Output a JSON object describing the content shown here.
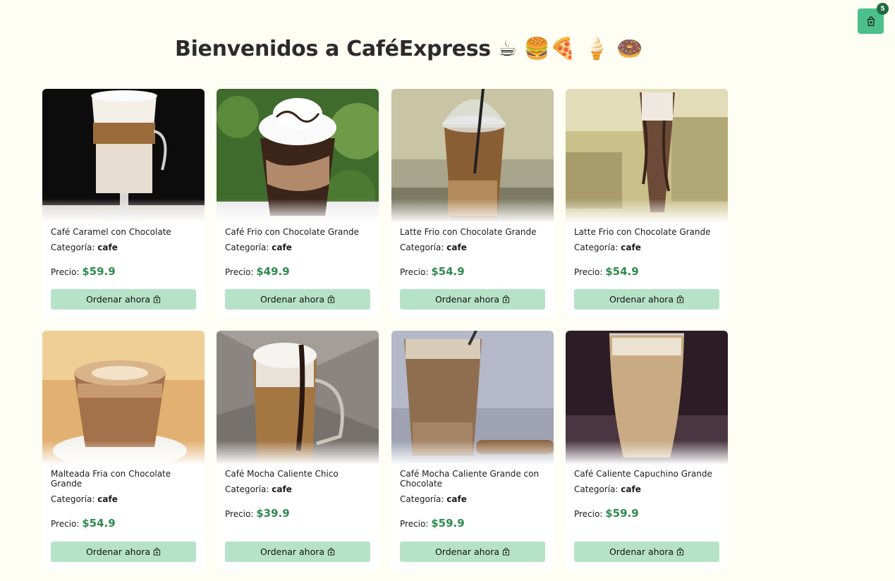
{
  "header": {
    "title": "Bienvenidos a CaféExpress ☕ 🍔🍕 🍦 🍩"
  },
  "cart": {
    "count": "5",
    "icon": "shopping-bag-icon"
  },
  "labels": {
    "category_prefix": "Categoría:",
    "price_prefix": "Precio:",
    "order_button": "Ordenar ahora"
  },
  "products": [
    {
      "name": "Café Caramel con Chocolate",
      "category": "cafe",
      "price": "$59.9"
    },
    {
      "name": "Café Frio con Chocolate Grande",
      "category": "cafe",
      "price": "$49.9"
    },
    {
      "name": "Latte Frio con Chocolate Grande",
      "category": "cafe",
      "price": "$54.9"
    },
    {
      "name": "Latte Frio con Chocolate Grande",
      "category": "cafe",
      "price": "$54.9"
    },
    {
      "name": "Malteada Fria con Chocolate Grande",
      "category": "cafe",
      "price": "$54.9"
    },
    {
      "name": "Café Mocha Caliente Chico",
      "category": "cafe",
      "price": "$39.9"
    },
    {
      "name": "Café Mocha Caliente Grande con Chocolate",
      "category": "cafe",
      "price": "$59.9"
    },
    {
      "name": "Café Caliente Capuchino Grande",
      "category": "cafe",
      "price": "$59.9"
    }
  ],
  "colors": {
    "accent": "#4cc08a",
    "button": "#b6e3c8",
    "price": "#2e8a4e",
    "background": "#fefef5"
  }
}
